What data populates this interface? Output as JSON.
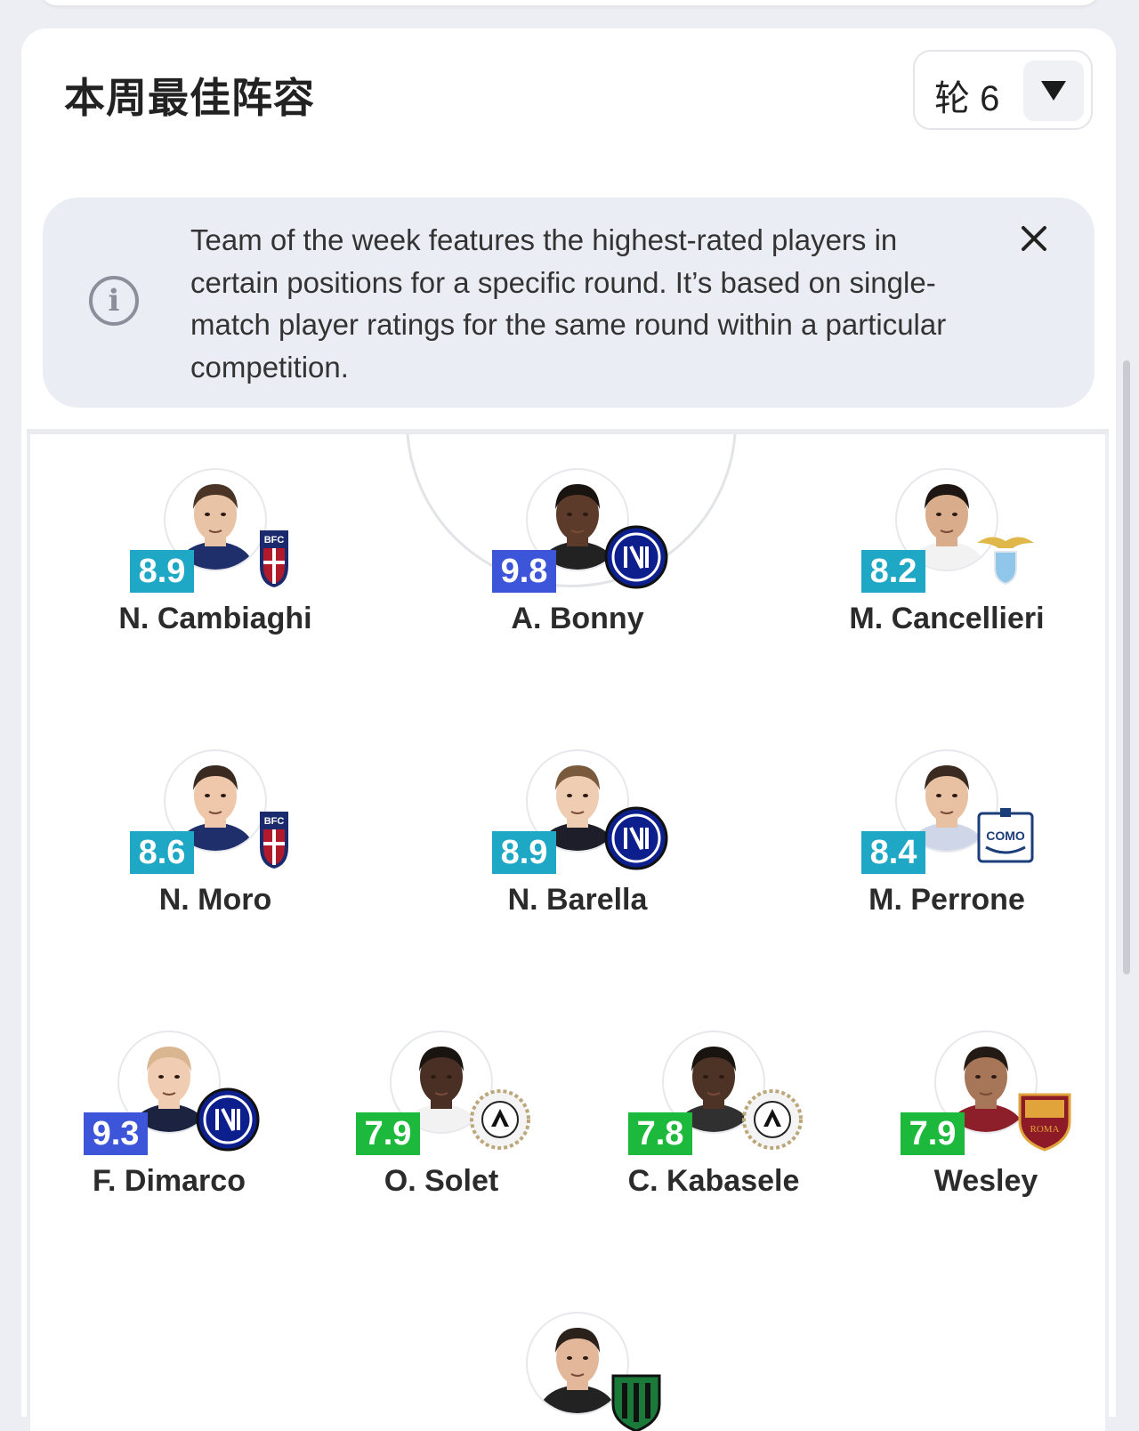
{
  "header": {
    "title": "本周最佳阵容",
    "round_label": "轮 6"
  },
  "info": {
    "text": "Team of the week features the highest-rated players in certain positions for a specific round. It’s based on single-match player ratings for the same round within a particular competition."
  },
  "colors": {
    "rating_teal": "#1ea8c6",
    "rating_blue": "#3d55d9",
    "rating_green": "#1db93c"
  },
  "players": [
    {
      "name": "N. Cambiaghi",
      "rating": "8.9",
      "rating_color": "teal",
      "club_icon": "bologna-crest-icon"
    },
    {
      "name": "A. Bonny",
      "rating": "9.8",
      "rating_color": "blue",
      "club_icon": "inter-crest-icon"
    },
    {
      "name": "M. Cancellieri",
      "rating": "8.2",
      "rating_color": "teal",
      "club_icon": "lazio-crest-icon"
    },
    {
      "name": "N. Moro",
      "rating": "8.6",
      "rating_color": "teal",
      "club_icon": "bologna-crest-icon"
    },
    {
      "name": "N. Barella",
      "rating": "8.9",
      "rating_color": "teal",
      "club_icon": "inter-crest-icon"
    },
    {
      "name": "M. Perrone",
      "rating": "8.4",
      "rating_color": "teal",
      "club_icon": "como-crest-icon"
    },
    {
      "name": "F. Dimarco",
      "rating": "9.3",
      "rating_color": "blue",
      "club_icon": "inter-crest-icon"
    },
    {
      "name": "O. Solet",
      "rating": "7.9",
      "rating_color": "green",
      "club_icon": "udinese-crest-icon"
    },
    {
      "name": "C. Kabasele",
      "rating": "7.8",
      "rating_color": "green",
      "club_icon": "udinese-crest-icon"
    },
    {
      "name": "Wesley",
      "rating": "7.9",
      "rating_color": "green",
      "club_icon": "roma-crest-icon"
    },
    {
      "name": "",
      "rating": "",
      "rating_color": "",
      "club_icon": "sassuolo-crest-icon"
    }
  ],
  "crest_text": {
    "bologna": "BFC",
    "como": "COMO",
    "roma": "ROMA"
  }
}
